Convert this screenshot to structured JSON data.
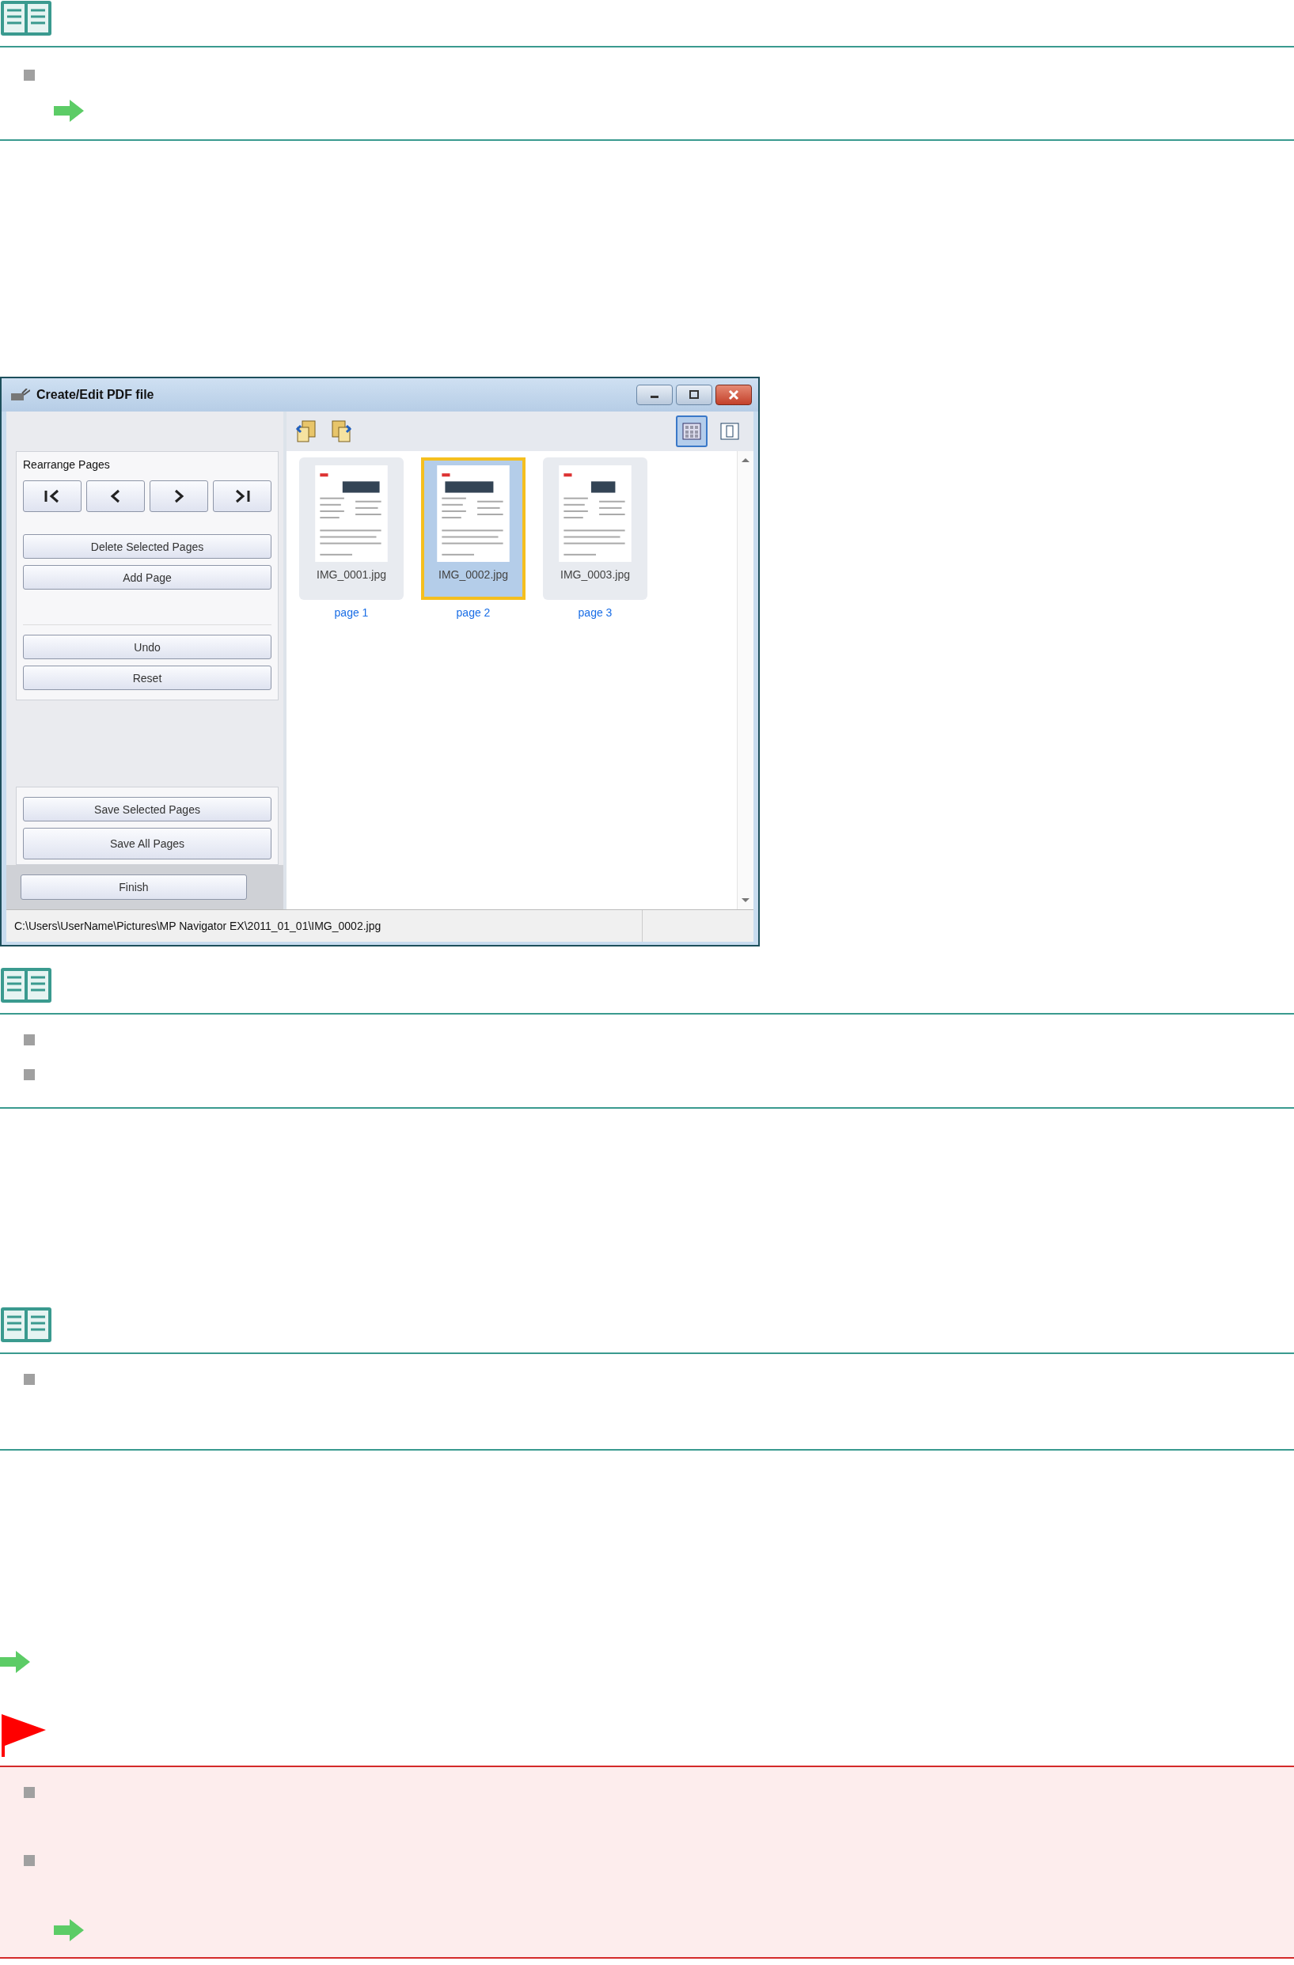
{
  "callouts_top": [
    {
      "kind": "note",
      "items": [
        {
          "kind": "bullet"
        },
        {
          "kind": "link"
        }
      ]
    }
  ],
  "window": {
    "title": "Create/Edit PDF file",
    "toolbar": {
      "views": [
        {
          "kind": "thumbnail",
          "selected": true
        },
        {
          "kind": "single",
          "selected": false
        }
      ]
    },
    "panel": {
      "group_label": "Rearrange Pages",
      "nav": [
        {
          "kind": "first"
        },
        {
          "kind": "prev"
        },
        {
          "kind": "next"
        },
        {
          "kind": "last"
        }
      ],
      "edit_buttons": [
        "Delete Selected Pages",
        "Add Page"
      ],
      "history_buttons": [
        "Undo",
        "Reset"
      ],
      "save_buttons": [
        "Save Selected Pages",
        "Save All Pages"
      ],
      "finish": "Finish"
    },
    "pages": [
      {
        "file": "IMG_0001.jpg",
        "label": "page 1",
        "selected": false
      },
      {
        "file": "IMG_0002.jpg",
        "label": "page 2",
        "selected": true
      },
      {
        "file": "IMG_0003.jpg",
        "label": "page 3",
        "selected": false
      }
    ],
    "status": "C:\\Users\\UserName\\Pictures\\MP Navigator EX\\2011_01_01\\IMG_0002.jpg"
  },
  "callouts_bottom": [
    {
      "kind": "note",
      "items": [
        {
          "kind": "bullet"
        },
        {
          "kind": "bullet"
        }
      ]
    },
    {
      "kind": "note",
      "items": [
        {
          "kind": "bullet"
        }
      ]
    },
    {
      "kind": "link_line"
    },
    {
      "kind": "caution",
      "items": [
        {
          "kind": "bullet"
        },
        {
          "kind": "bullet"
        },
        {
          "kind": "link"
        }
      ]
    }
  ]
}
